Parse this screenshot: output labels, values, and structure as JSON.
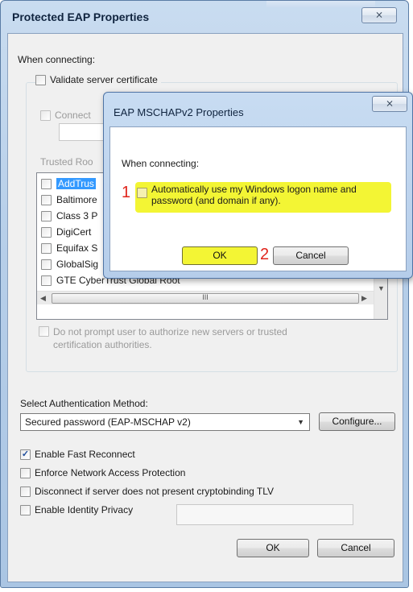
{
  "main": {
    "title": "Protected EAP Properties",
    "close_glyph": "⨯",
    "when_connecting": "When connecting:",
    "validate_cert": "Validate server certificate",
    "connect_to": "Connect",
    "trusted_roots_label": "Trusted Roo",
    "cert_list": [
      {
        "label": "AddTrus",
        "selected": true
      },
      {
        "label": "Baltimore",
        "selected": false
      },
      {
        "label": "Class 3 P",
        "selected": false
      },
      {
        "label": "DigiCert",
        "selected": false
      },
      {
        "label": "Equifax S",
        "selected": false
      },
      {
        "label": "GlobalSig",
        "selected": false
      },
      {
        "label": "GTE CyberTrust Global Root",
        "selected": false
      }
    ],
    "hscroll_grip": "III",
    "no_prompt_line1": "Do not prompt user to authorize new servers or trusted",
    "no_prompt_line2": "certification authorities.",
    "auth_method_label": "Select Authentication Method:",
    "auth_method_value": "Secured password (EAP-MSCHAP v2)",
    "configure_btn": "Configure...",
    "fast_reconnect": "Enable Fast Reconnect",
    "fast_reconnect_checked": true,
    "nap": "Enforce Network Access Protection",
    "cryptobinding": "Disconnect if server does not present cryptobinding TLV",
    "identity_privacy": "Enable Identity Privacy",
    "ok_btn": "OK",
    "cancel_btn": "Cancel"
  },
  "sub_dialog": {
    "title": "EAP MSCHAPv2 Properties",
    "close_glyph": "⨯",
    "when_connecting": "When connecting:",
    "auto_logon_line1": "Automatically use my Windows logon name and",
    "auto_logon_line2": "password (and domain if any).",
    "marker1": "1",
    "marker2": "2",
    "ok_btn": "OK",
    "cancel_btn": "Cancel",
    "highlight_color": "#f3f534"
  },
  "icons": {
    "check_glyph": "✓",
    "arrow_left": "◀",
    "arrow_right": "▶",
    "arrow_down": "▼"
  }
}
